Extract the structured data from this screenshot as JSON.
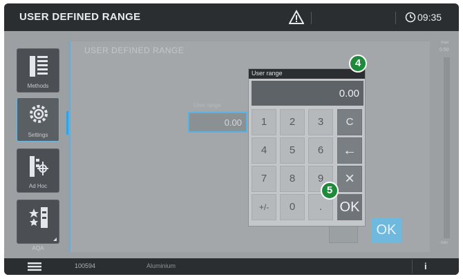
{
  "header": {
    "title": "USER DEFINED RANGE",
    "time": "09:35"
  },
  "sidebar": {
    "items": [
      {
        "label": "Methods",
        "icon": "methods-list-icon"
      },
      {
        "label": "Settings",
        "icon": "settings-gear-icon"
      },
      {
        "label": "Ad Hoc",
        "icon": "ad-hoc-icon"
      },
      {
        "label": "AQA",
        "icon": "aqa-icon"
      }
    ]
  },
  "main": {
    "title": "USER DEFINED RANGE",
    "range_label": "User range",
    "range_value": "0.00",
    "ok_label": "OK"
  },
  "scale": {
    "max_label": "max",
    "max_value": "0.50",
    "min_label": "min"
  },
  "keypad": {
    "title": "User range",
    "display": "0.00",
    "keys": [
      "1",
      "2",
      "3",
      "C",
      "4",
      "5",
      "6",
      "←",
      "7",
      "8",
      "9",
      "×",
      "+/-",
      "0",
      ".",
      "OK"
    ]
  },
  "callouts": {
    "badge_4": "4",
    "badge_5": "5"
  },
  "footer": {
    "code": "100594",
    "material": "Aluminium",
    "info": "i"
  },
  "colors": {
    "accent": "#5ab2e3",
    "badge": "#1f8a3c",
    "bar": "#2b2e31"
  }
}
